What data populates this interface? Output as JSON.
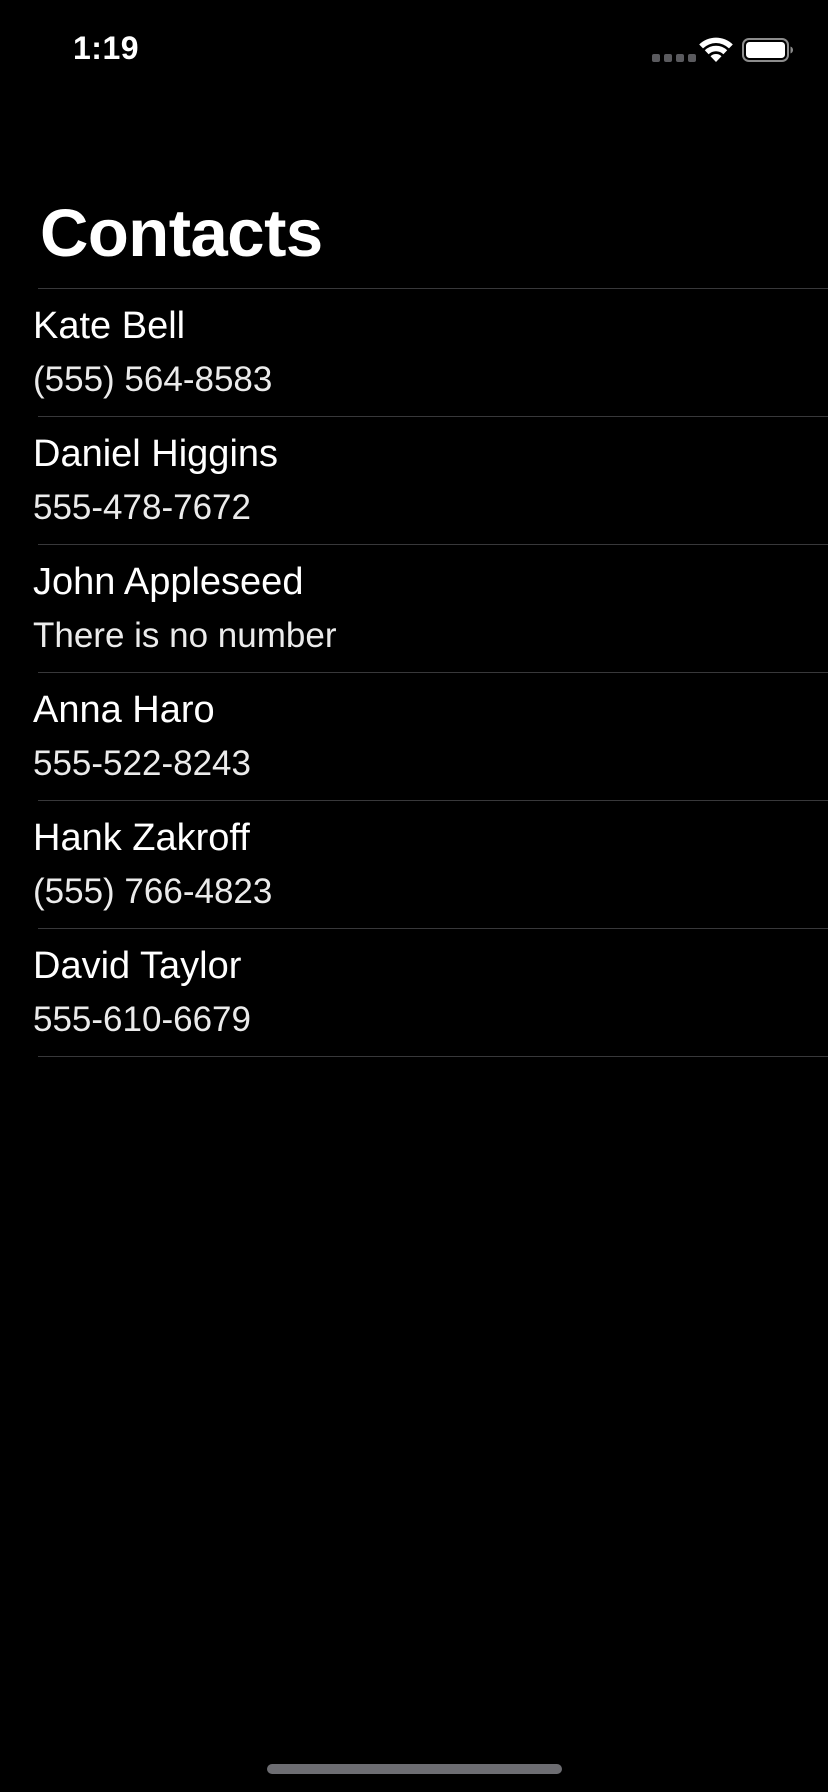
{
  "status_bar": {
    "time": "1:19",
    "signal_icon": "cellular-signal-icon",
    "wifi_icon": "wifi-icon",
    "battery_icon": "battery-icon"
  },
  "navigation": {
    "title": "Contacts"
  },
  "contacts": [
    {
      "name": "Kate Bell",
      "number": "(555) 564-8583"
    },
    {
      "name": "Daniel Higgins",
      "number": "555-478-7672"
    },
    {
      "name": "John Appleseed",
      "number": "There is no number"
    },
    {
      "name": "Anna Haro",
      "number": "555-522-8243"
    },
    {
      "name": "Hank Zakroff",
      "number": "(555) 766-4823"
    },
    {
      "name": "David Taylor",
      "number": "555-610-6679"
    }
  ],
  "colors": {
    "background": "#000000",
    "text": "#ffffff",
    "separator": "#38383a"
  }
}
